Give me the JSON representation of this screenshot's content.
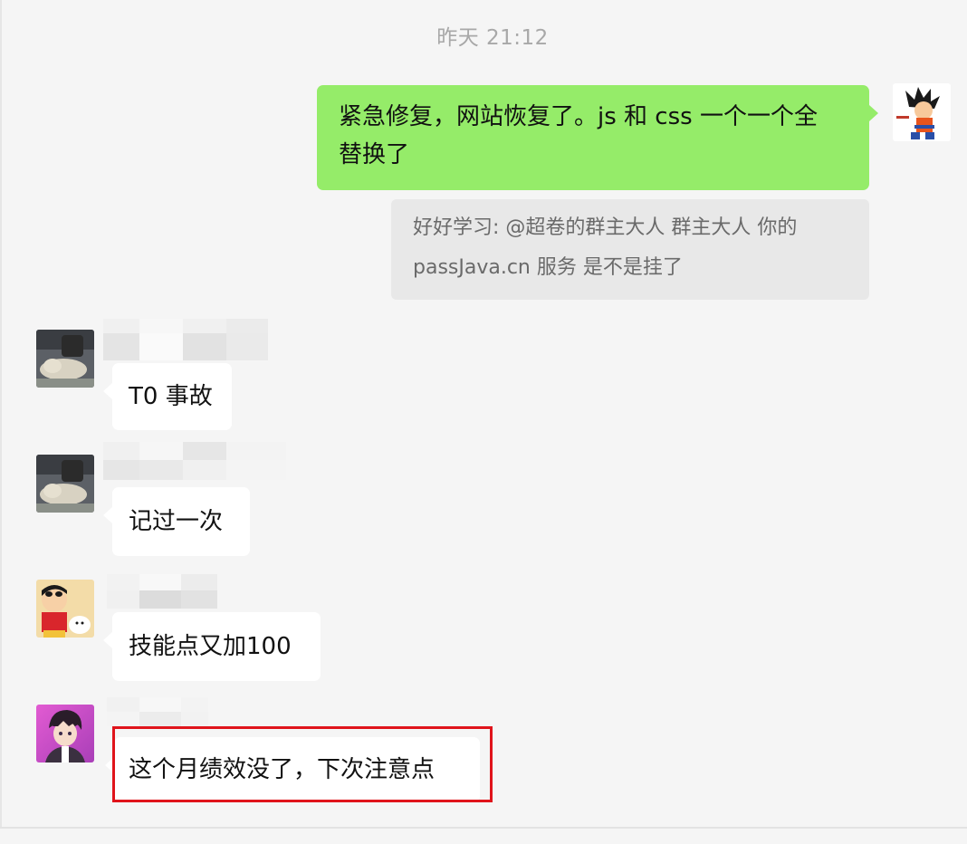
{
  "chat": {
    "timestamp": "昨天 21:12",
    "self_message": {
      "text_line1": "紧急修复，网站恢复了。js 和 css 一个一个全",
      "text_line2": "替换了",
      "avatar_icon": "goku-avatar-icon"
    },
    "quote": {
      "line1": "好好学习: @超卷的群主大人  群主大人 你的",
      "line2": "passJava.cn 服务 是不是挂了"
    },
    "messages": [
      {
        "text": "T0 事故",
        "avatar_icon": "person-photo-avatar-icon"
      },
      {
        "text": "记过一次",
        "avatar_icon": "person-photo-avatar-icon"
      },
      {
        "text": "技能点又加100",
        "avatar_icon": "crayon-shinchan-avatar-icon"
      },
      {
        "text": "这个月绩效没了，下次注意点",
        "avatar_icon": "anime-boy-avatar-icon"
      }
    ]
  },
  "colors": {
    "self_bubble": "#95ec69",
    "other_bubble": "#ffffff",
    "background": "#f5f5f5",
    "highlight_border": "#e0141b"
  }
}
